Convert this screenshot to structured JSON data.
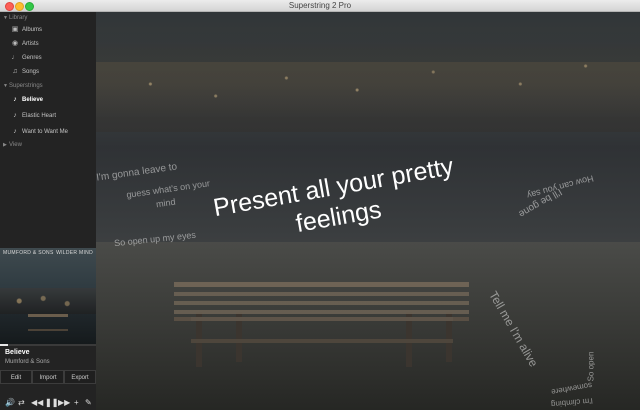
{
  "window": {
    "title": "Superstring 2 Pro"
  },
  "sidebar": {
    "library_label": "Library",
    "library_items": [
      {
        "label": "Albums",
        "icon": "album-icon"
      },
      {
        "label": "Artists",
        "icon": "artist-icon"
      },
      {
        "label": "Genres",
        "icon": "genre-icon"
      },
      {
        "label": "Songs",
        "icon": "song-icon"
      }
    ],
    "superstrings_label": "Superstrings",
    "superstring_items": [
      {
        "label": "Believe",
        "icon": "note-icon",
        "active": true
      },
      {
        "label": "Elastic Heart",
        "icon": "note-icon",
        "active": false
      },
      {
        "label": "Want to Want Me",
        "icon": "note-icon",
        "active": false
      }
    ],
    "view_label": "View"
  },
  "album_art": {
    "left_text": "MUMFORD & SONS",
    "right_text": "WILDER MIND"
  },
  "now_playing": {
    "title": "Believe",
    "artist": "Mumford & Sons",
    "progress": 0.08
  },
  "buttons": {
    "edit": "Edit",
    "import": "Import",
    "export": "Export"
  },
  "lyrics": {
    "main": "Present all your pretty feelings",
    "floating": [
      "I'm gonna leave to",
      "guess what's on your",
      "mind",
      "So open up my eyes",
      "Tell me I'm alive",
      "I'll be gone",
      "How can you say",
      "somewhere",
      "So open",
      "I'm climbing"
    ]
  }
}
